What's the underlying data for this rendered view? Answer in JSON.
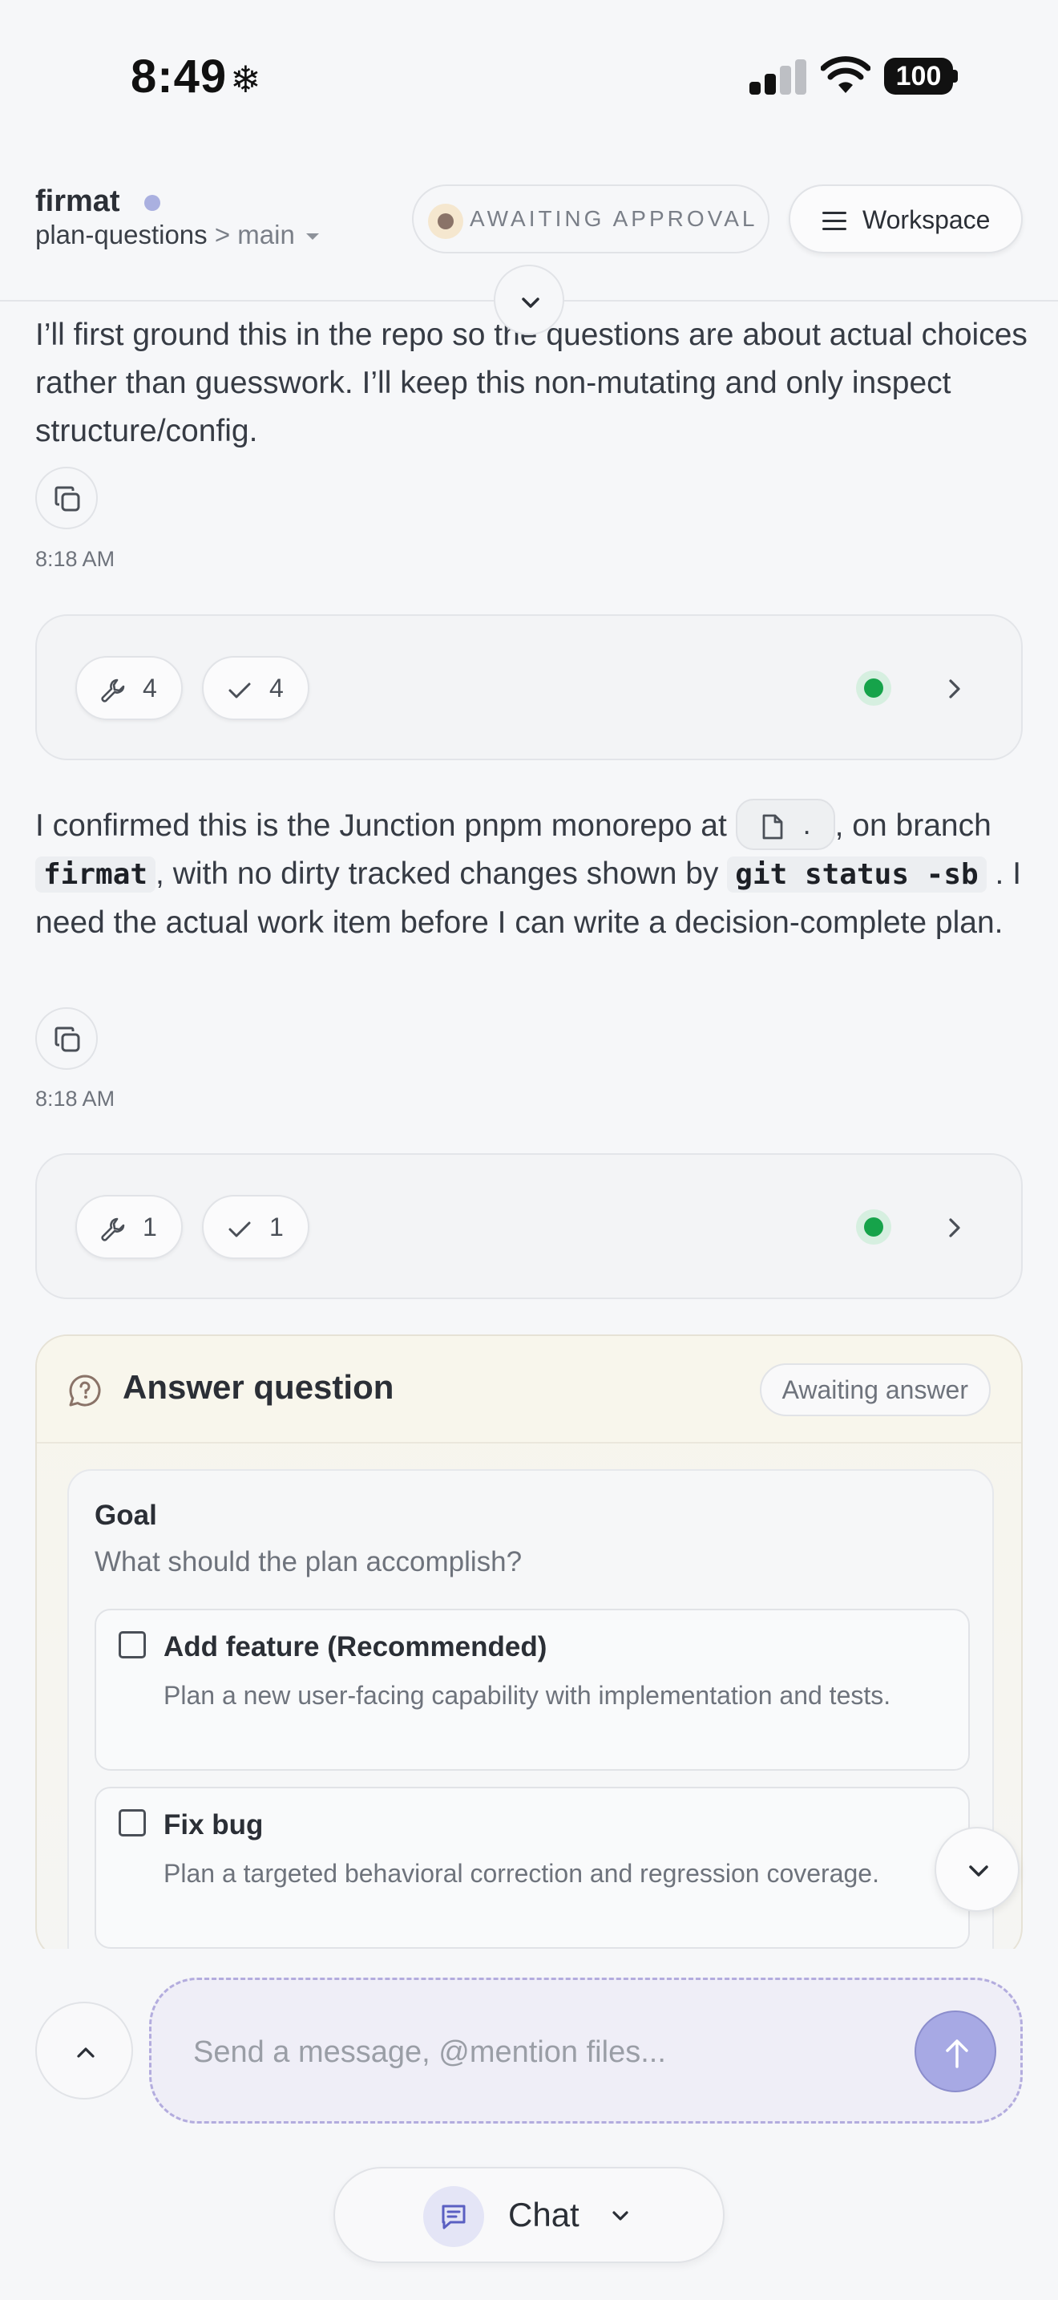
{
  "status_bar": {
    "time": "8:49",
    "time_glyph": "❄",
    "battery": "100"
  },
  "header": {
    "project": "firmat",
    "branch": "plan-questions",
    "branch_sep": ">",
    "branch_target": "main",
    "status": "AWAITING APPROVAL",
    "workspace_label": "Workspace"
  },
  "messages": [
    {
      "text": "I’ll first ground this in the repo so the questions are about actual choices rather than guesswork. I’ll keep this non-mutating and only inspect structure/config.",
      "time": "8:18 AM"
    },
    {
      "part1": "I confirmed this is the Junction pnpm monorepo at",
      "file_chip": ".",
      "part2": ", on branch",
      "code1": "firmat",
      "part3": ", with no dirty tracked changes shown by",
      "code2": "git status -sb",
      "part4": ". I need the actual work item before I can write a decision-complete plan.",
      "time": "8:18 AM"
    }
  ],
  "tool_cards": [
    {
      "tools": "4",
      "checks": "4"
    },
    {
      "tools": "1",
      "checks": "1"
    }
  ],
  "question": {
    "title": "Answer question",
    "badge": "Awaiting answer",
    "heading": "Goal",
    "prompt": "What should the plan accomplish?",
    "options": [
      {
        "label": "Add feature (Recommended)",
        "description": "Plan a new user-facing capability with implementation and tests."
      },
      {
        "label": "Fix bug",
        "description": "Plan a targeted behavioral correction and regression coverage."
      }
    ]
  },
  "composer": {
    "placeholder": "Send a message, @mention files...",
    "value": ""
  },
  "mode": {
    "label": "Chat"
  },
  "colors": {
    "accent": "#a7a9e4",
    "success": "#16a34a",
    "background": "#f6f7f9"
  }
}
